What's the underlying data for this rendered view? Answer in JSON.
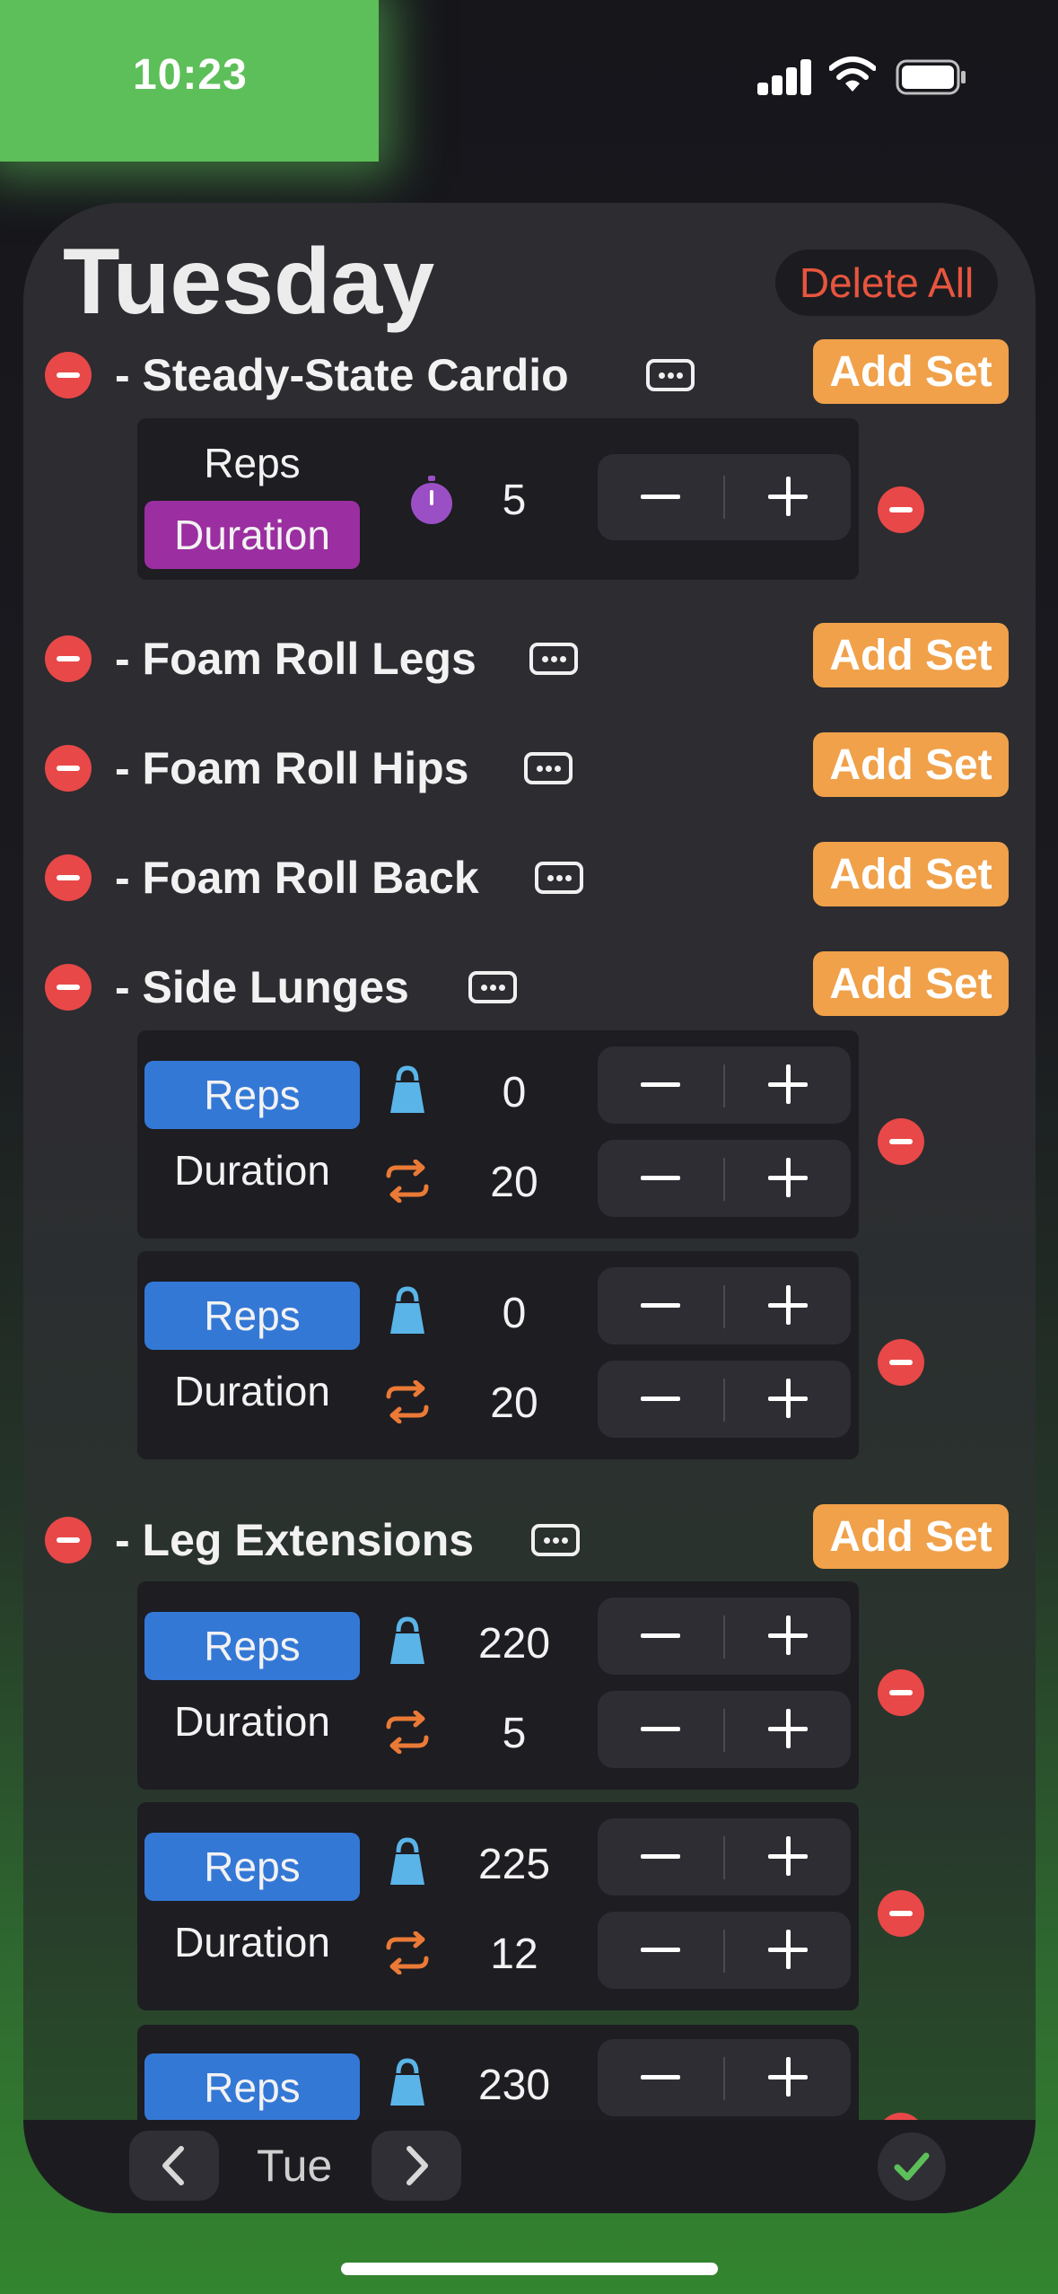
{
  "status_bar": {
    "time": "10:23"
  },
  "header": {
    "title": "Tuesday",
    "delete_all": "Delete All"
  },
  "labels": {
    "reps": "Reps",
    "duration": "Duration",
    "add_set": "Add Set"
  },
  "exercises": [
    {
      "name": "- Steady-State Cardio",
      "sets": [
        {
          "mode": "Duration",
          "value": "5"
        }
      ]
    },
    {
      "name": "- Foam Roll Legs",
      "sets": []
    },
    {
      "name": "- Foam Roll Hips",
      "sets": []
    },
    {
      "name": "- Foam Roll Back",
      "sets": []
    },
    {
      "name": "- Side Lunges",
      "sets": [
        {
          "mode": "Reps",
          "weight": "0",
          "reps": "20"
        },
        {
          "mode": "Reps",
          "weight": "0",
          "reps": "20"
        }
      ]
    },
    {
      "name": "- Leg Extensions",
      "sets": [
        {
          "mode": "Reps",
          "weight": "220",
          "reps": "5"
        },
        {
          "mode": "Reps",
          "weight": "225",
          "reps": "12"
        },
        {
          "mode": "Reps",
          "weight": "230"
        }
      ]
    }
  ],
  "bottom_nav": {
    "day": "Tue"
  },
  "colors": {
    "accent_orange": "#f0a14a",
    "delete_red": "#e84848",
    "reps_blue": "#3478d6",
    "duration_purple": "#9b2ea0",
    "check_green": "#5dbf59"
  },
  "icons": [
    "signal-icon",
    "wifi-icon",
    "battery-icon",
    "more-icon",
    "timer-icon",
    "kettlebell-icon",
    "repeat-icon",
    "chevron-left-icon",
    "chevron-right-icon",
    "checkmark-icon"
  ]
}
